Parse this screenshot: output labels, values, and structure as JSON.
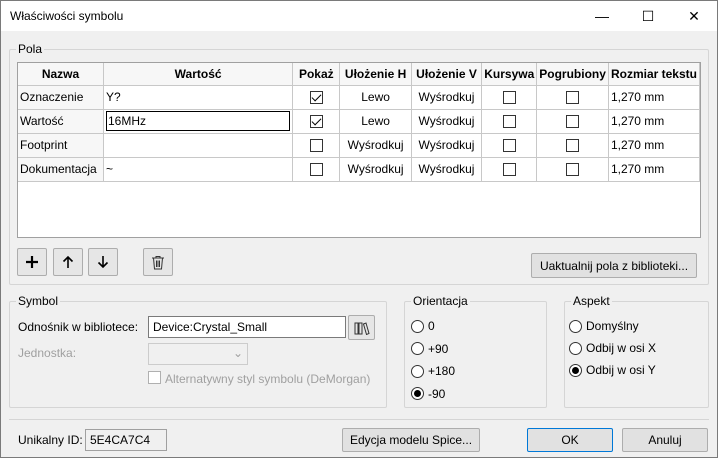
{
  "window": {
    "title": "Właściwości symbolu",
    "minimize": "—",
    "maximize": "☐",
    "close": "✕"
  },
  "fields": {
    "group_label": "Pola",
    "columns": [
      "Nazwa",
      "Wartość",
      "Pokaż",
      "Ułożenie H",
      "Ułożenie V",
      "Kursywa",
      "Pogrubiony",
      "Rozmiar tekstu"
    ],
    "rows": [
      {
        "name": "Oznaczenie",
        "value": "Y?",
        "show": true,
        "h_align": "Lewo",
        "v_align": "Wyśrodkuj",
        "italic": false,
        "bold": false,
        "text_size": "1,270 mm"
      },
      {
        "name": "Wartość",
        "value": "16MHz",
        "show": true,
        "h_align": "Lewo",
        "v_align": "Wyśrodkuj",
        "italic": false,
        "bold": false,
        "text_size": "1,270 mm"
      },
      {
        "name": "Footprint",
        "value": "",
        "show": false,
        "h_align": "Wyśrodkuj",
        "v_align": "Wyśrodkuj",
        "italic": false,
        "bold": false,
        "text_size": "1,270 mm"
      },
      {
        "name": "Dokumentacja",
        "value": "~",
        "show": false,
        "h_align": "Wyśrodkuj",
        "v_align": "Wyśrodkuj",
        "italic": false,
        "bold": false,
        "text_size": "1,270 mm"
      }
    ],
    "update_button": "Uaktualnij pola z biblioteki..."
  },
  "symbol": {
    "group_label": "Symbol",
    "lib_link_label": "Odnośnik w bibliotece:",
    "lib_link_value": "Device:Crystal_Small",
    "unit_label": "Jednostka:",
    "unit_value": "",
    "demorgan_label": "Alternatywny styl symbolu (DeMorgan)"
  },
  "orientation": {
    "group_label": "Orientacja",
    "options": [
      "0",
      "+90",
      "+180",
      "-90"
    ],
    "selected": "-90"
  },
  "aspect": {
    "group_label": "Aspekt",
    "options": [
      "Domyślny",
      "Odbij w osi X",
      "Odbij w osi Y"
    ],
    "selected": "Odbij w osi Y"
  },
  "footer": {
    "unique_id_label": "Unikalny ID:",
    "unique_id_value": "5E4CA7C4",
    "spice_button": "Edycja modelu Spice...",
    "ok_button": "OK",
    "cancel_button": "Anuluj"
  }
}
